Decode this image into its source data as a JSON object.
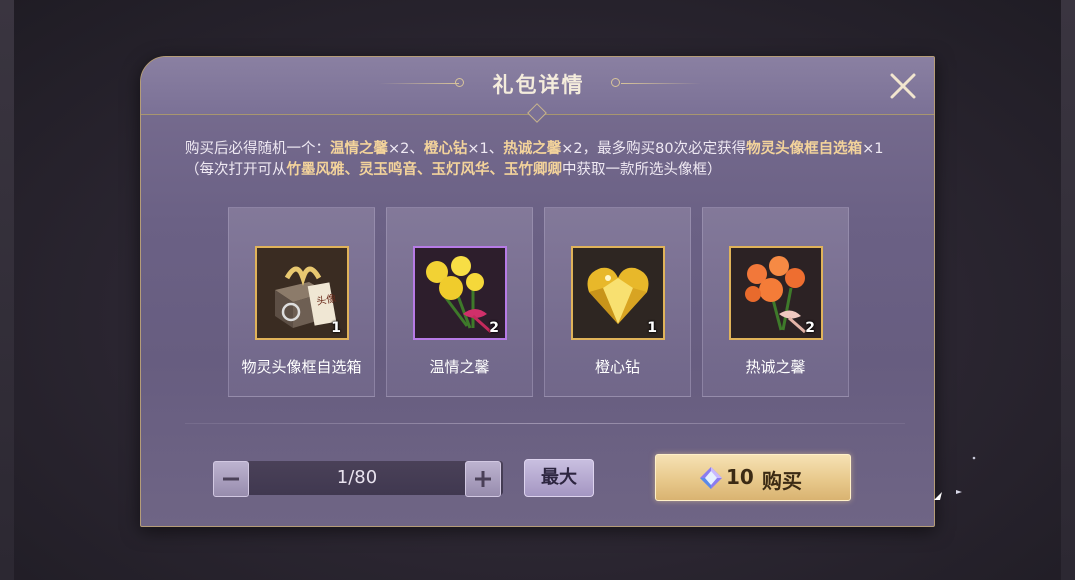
{
  "dialog": {
    "title": "礼包详情",
    "close_icon": "close-icon"
  },
  "description": {
    "part1": "购买后必得随机一个：",
    "hl1": "温情之馨",
    "part2": "×2、",
    "hl2": "橙心钻",
    "part3": "×1、",
    "hl3": "热诚之馨",
    "part4": "×2，最多购买80次必定获得",
    "hl4": "物灵头像框自选箱",
    "part5": "×1（每次打开可从",
    "hl5": "竹墨风雅、灵玉鸣音、玉灯风华、玉竹卿卿",
    "part6": "中获取一款所选头像框）"
  },
  "items": [
    {
      "name": "物灵头像框自选箱",
      "count": "1",
      "icon": "avatar-frame-box-icon",
      "rarity_color": "#e0b35a"
    },
    {
      "name": "温情之馨",
      "count": "2",
      "icon": "yellow-rose-bouquet-icon",
      "rarity_color": "#b77be6"
    },
    {
      "name": "橙心钻",
      "count": "1",
      "icon": "golden-heart-diamond-icon",
      "rarity_color": "#e0b35a"
    },
    {
      "name": "热诚之馨",
      "count": "2",
      "icon": "orange-rose-bouquet-icon",
      "rarity_color": "#e0b35a"
    }
  ],
  "quantity": {
    "value": "1/80",
    "max_label": "最大"
  },
  "buy": {
    "price": "10",
    "label": "购买",
    "currency_icon": "diamond-gem-icon"
  }
}
